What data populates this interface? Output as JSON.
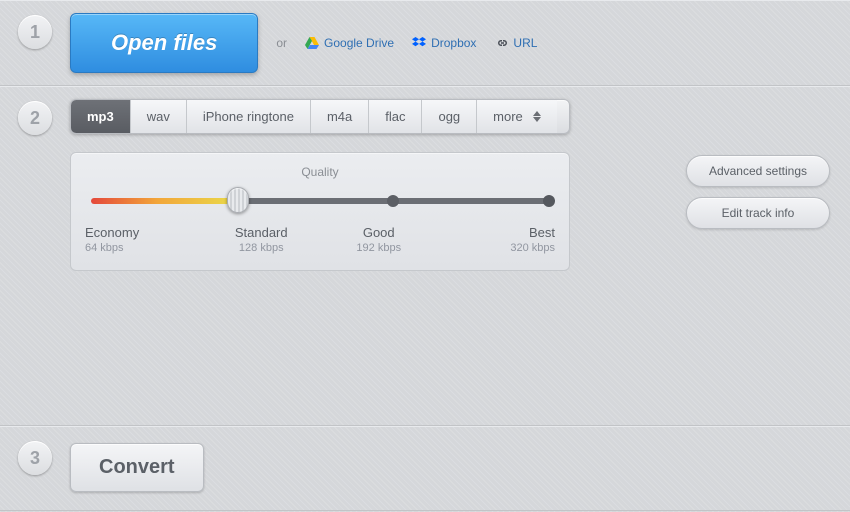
{
  "steps": {
    "one": "1",
    "two": "2",
    "three": "3"
  },
  "open": {
    "button": "Open files",
    "or": "or",
    "sources": {
      "google_drive": "Google Drive",
      "dropbox": "Dropbox",
      "url": "URL"
    }
  },
  "formats": {
    "tabs": [
      "mp3",
      "wav",
      "iPhone ringtone",
      "m4a",
      "flac",
      "ogg",
      "more"
    ],
    "active_index": 0
  },
  "quality": {
    "title": "Quality",
    "stops": [
      {
        "name": "Economy",
        "bitrate": "64 kbps"
      },
      {
        "name": "Standard",
        "bitrate": "128 kbps"
      },
      {
        "name": "Good",
        "bitrate": "192 kbps"
      },
      {
        "name": "Best",
        "bitrate": "320 kbps"
      }
    ],
    "selected_index": 1
  },
  "side_buttons": {
    "advanced": "Advanced settings",
    "edit_track": "Edit track info"
  },
  "convert": {
    "label": "Convert"
  }
}
